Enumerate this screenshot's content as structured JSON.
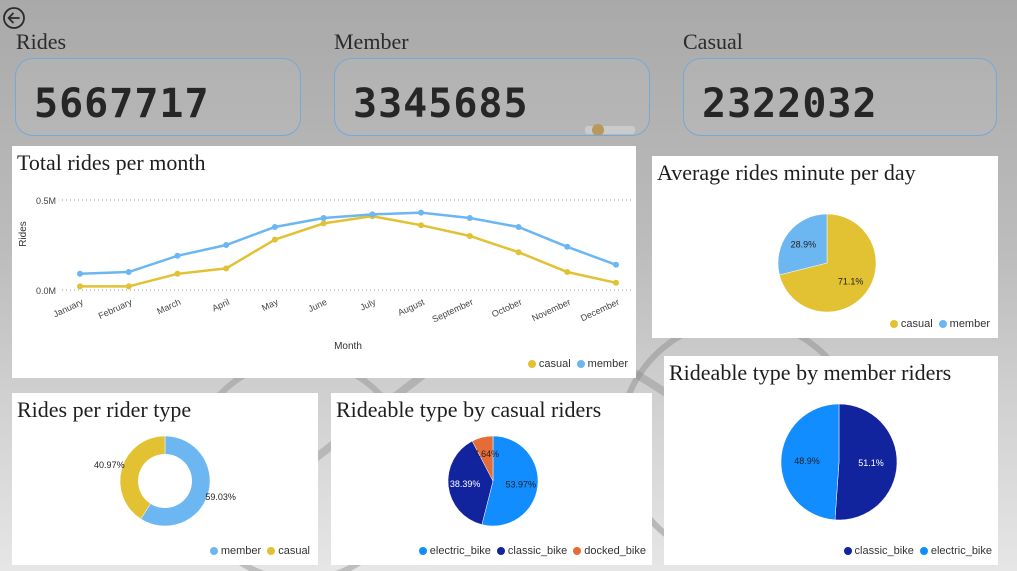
{
  "kpis": {
    "rides": {
      "label": "Rides",
      "value": "5667717"
    },
    "member": {
      "label": "Member",
      "value": "3345685"
    },
    "casual": {
      "label": "Casual",
      "value": "2322032"
    }
  },
  "colors": {
    "casual": "#e2c133",
    "member": "#6cb6f2",
    "electric_bike": "#118dff",
    "classic_bike": "#12239e",
    "docked_bike": "#e66c37",
    "kpi_border": "#76a9d8"
  },
  "panels": {
    "monthly": {
      "title": "Total rides per month",
      "legend": [
        "casual",
        "member"
      ]
    },
    "avg_minutes": {
      "title": "Average rides minute per day",
      "legend": [
        "casual",
        "member"
      ]
    },
    "rider_type": {
      "title": "Rides per rider type",
      "legend": [
        "member",
        "casual"
      ]
    },
    "casual_rideable": {
      "title": "Rideable type by casual riders",
      "legend": [
        "electric_bike",
        "classic_bike",
        "docked_bike"
      ]
    },
    "member_rideable": {
      "title": "Rideable type by member riders",
      "legend": [
        "classic_bike",
        "electric_bike"
      ]
    }
  },
  "chart_data": [
    {
      "type": "line",
      "title": "Total rides per month",
      "xlabel": "Month",
      "ylabel": "Rides",
      "categories": [
        "January",
        "February",
        "March",
        "April",
        "May",
        "June",
        "July",
        "August",
        "September",
        "October",
        "November",
        "December"
      ],
      "y_ticks": [
        "0.0M",
        "0.5M"
      ],
      "ylim": [
        0,
        0.5
      ],
      "grid": true,
      "legend_position": "bottom-right",
      "series": [
        {
          "name": "casual",
          "values": [
            0.02,
            0.02,
            0.09,
            0.12,
            0.28,
            0.37,
            0.41,
            0.36,
            0.3,
            0.21,
            0.1,
            0.04
          ]
        },
        {
          "name": "member",
          "values": [
            0.09,
            0.1,
            0.19,
            0.25,
            0.35,
            0.4,
            0.42,
            0.43,
            0.4,
            0.35,
            0.24,
            0.14
          ]
        }
      ]
    },
    {
      "type": "pie",
      "title": "Average rides minute per day",
      "legend_position": "bottom-right",
      "slices": [
        {
          "name": "casual",
          "value": 71.1,
          "label": "71.1%"
        },
        {
          "name": "member",
          "value": 28.9,
          "label": "28.9%"
        }
      ]
    },
    {
      "type": "pie",
      "donut": true,
      "title": "Rides per rider type",
      "legend_position": "bottom-right",
      "slices": [
        {
          "name": "member",
          "value": 59.03,
          "label": "59.03%"
        },
        {
          "name": "casual",
          "value": 40.97,
          "label": "40.97%"
        }
      ]
    },
    {
      "type": "pie",
      "title": "Rideable type by casual riders",
      "legend_position": "bottom-right",
      "slices": [
        {
          "name": "electric_bike",
          "value": 53.97,
          "label": "53.97%"
        },
        {
          "name": "classic_bike",
          "value": 38.39,
          "label": "38.39%"
        },
        {
          "name": "docked_bike",
          "value": 7.64,
          "label": "7.64%"
        }
      ]
    },
    {
      "type": "pie",
      "title": "Rideable type by member riders",
      "legend_position": "bottom-right",
      "slices": [
        {
          "name": "classic_bike",
          "value": 51.1,
          "label": "51.1%"
        },
        {
          "name": "electric_bike",
          "value": 48.9,
          "label": "48.9%"
        }
      ]
    }
  ]
}
